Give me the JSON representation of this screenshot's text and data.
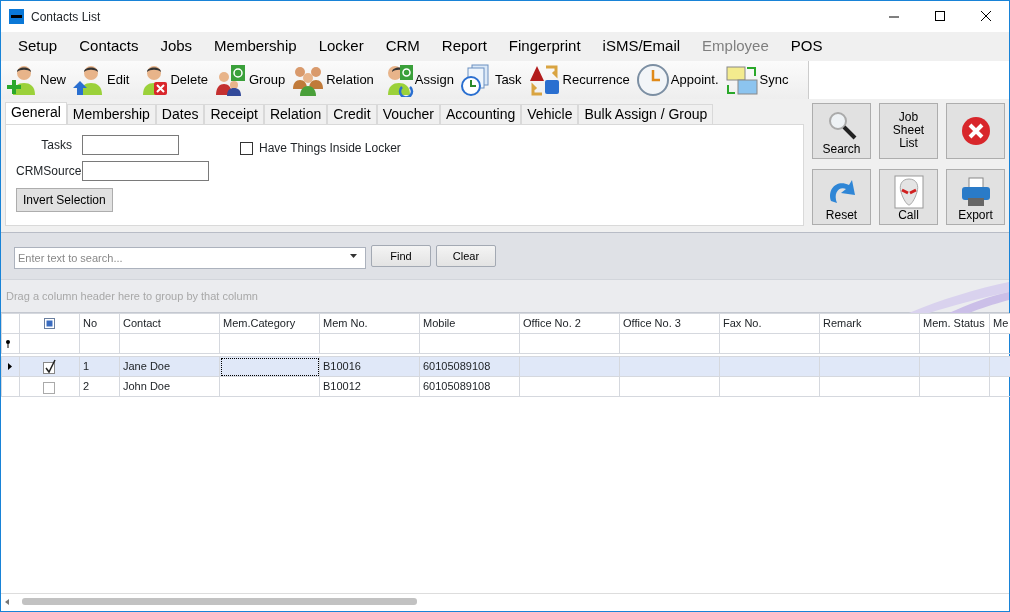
{
  "window": {
    "title": "Contacts List"
  },
  "menu": [
    {
      "label": "Setup",
      "disabled": false
    },
    {
      "label": "Contacts",
      "disabled": false
    },
    {
      "label": "Jobs",
      "disabled": false
    },
    {
      "label": "Membership",
      "disabled": false
    },
    {
      "label": "Locker",
      "disabled": false
    },
    {
      "label": "CRM",
      "disabled": false
    },
    {
      "label": "Report",
      "disabled": false
    },
    {
      "label": "Fingerprint",
      "disabled": false
    },
    {
      "label": "iSMS/Email",
      "disabled": false
    },
    {
      "label": "Employee",
      "disabled": true
    },
    {
      "label": "POS",
      "disabled": false
    }
  ],
  "toolbar": [
    {
      "label": "New"
    },
    {
      "label": "Edit"
    },
    {
      "label": "Delete"
    },
    {
      "label": "Group"
    },
    {
      "label": "Relation"
    },
    {
      "label": "Assign"
    },
    {
      "label": "Task"
    },
    {
      "label": "Recurrence"
    },
    {
      "label": "Appoint."
    },
    {
      "label": "Sync"
    }
  ],
  "tabs": [
    {
      "label": "General",
      "selected": true
    },
    {
      "label": "Membership",
      "selected": false
    },
    {
      "label": "Dates",
      "selected": false
    },
    {
      "label": "Receipt",
      "selected": false
    },
    {
      "label": "Relation",
      "selected": false
    },
    {
      "label": "Credit",
      "selected": false
    },
    {
      "label": "Voucher",
      "selected": false
    },
    {
      "label": "Accounting",
      "selected": false
    },
    {
      "label": "Vehicle",
      "selected": false
    },
    {
      "label": "Bulk Assign / Group",
      "selected": false
    }
  ],
  "filters": {
    "fields": [
      {
        "label": "Tasks",
        "kind": "short"
      },
      {
        "label": "CRMSource",
        "kind": "long"
      }
    ],
    "locker_checkbox": {
      "label": "Have Things Inside Locker",
      "checked": false
    },
    "invert_button": "Invert Selection"
  },
  "side_buttons": [
    {
      "label": "Search",
      "kind": "search"
    },
    {
      "label": "Job Sheet List",
      "kind": "text"
    },
    {
      "kind": "close"
    },
    {
      "label": "Reset",
      "kind": "reset"
    },
    {
      "label": "Call",
      "kind": "call"
    },
    {
      "label": "Export",
      "kind": "export"
    }
  ],
  "search": {
    "placeholder": "Enter text to search...",
    "find": "Find",
    "clear": "Clear"
  },
  "group_panel": "Drag a column header here to group by that column",
  "grid": {
    "header_checkbox_partial": true,
    "columns": [
      "No",
      "Contact",
      "Mem.Category",
      "Mem No.",
      "Mobile",
      "Office No. 2",
      "Office No. 3",
      "Fax No.",
      "Remark",
      "Mem. Status",
      "Me"
    ],
    "rows": [
      {
        "selected": true,
        "checked": true,
        "no": "1",
        "contact": "Jane Doe",
        "category_focused": true,
        "mem_no": "B10016",
        "mobile": "60105089108"
      },
      {
        "selected": false,
        "checked": false,
        "no": "2",
        "contact": "John Doe",
        "category_focused": false,
        "mem_no": "B10012",
        "mobile": "60105089108"
      }
    ]
  }
}
